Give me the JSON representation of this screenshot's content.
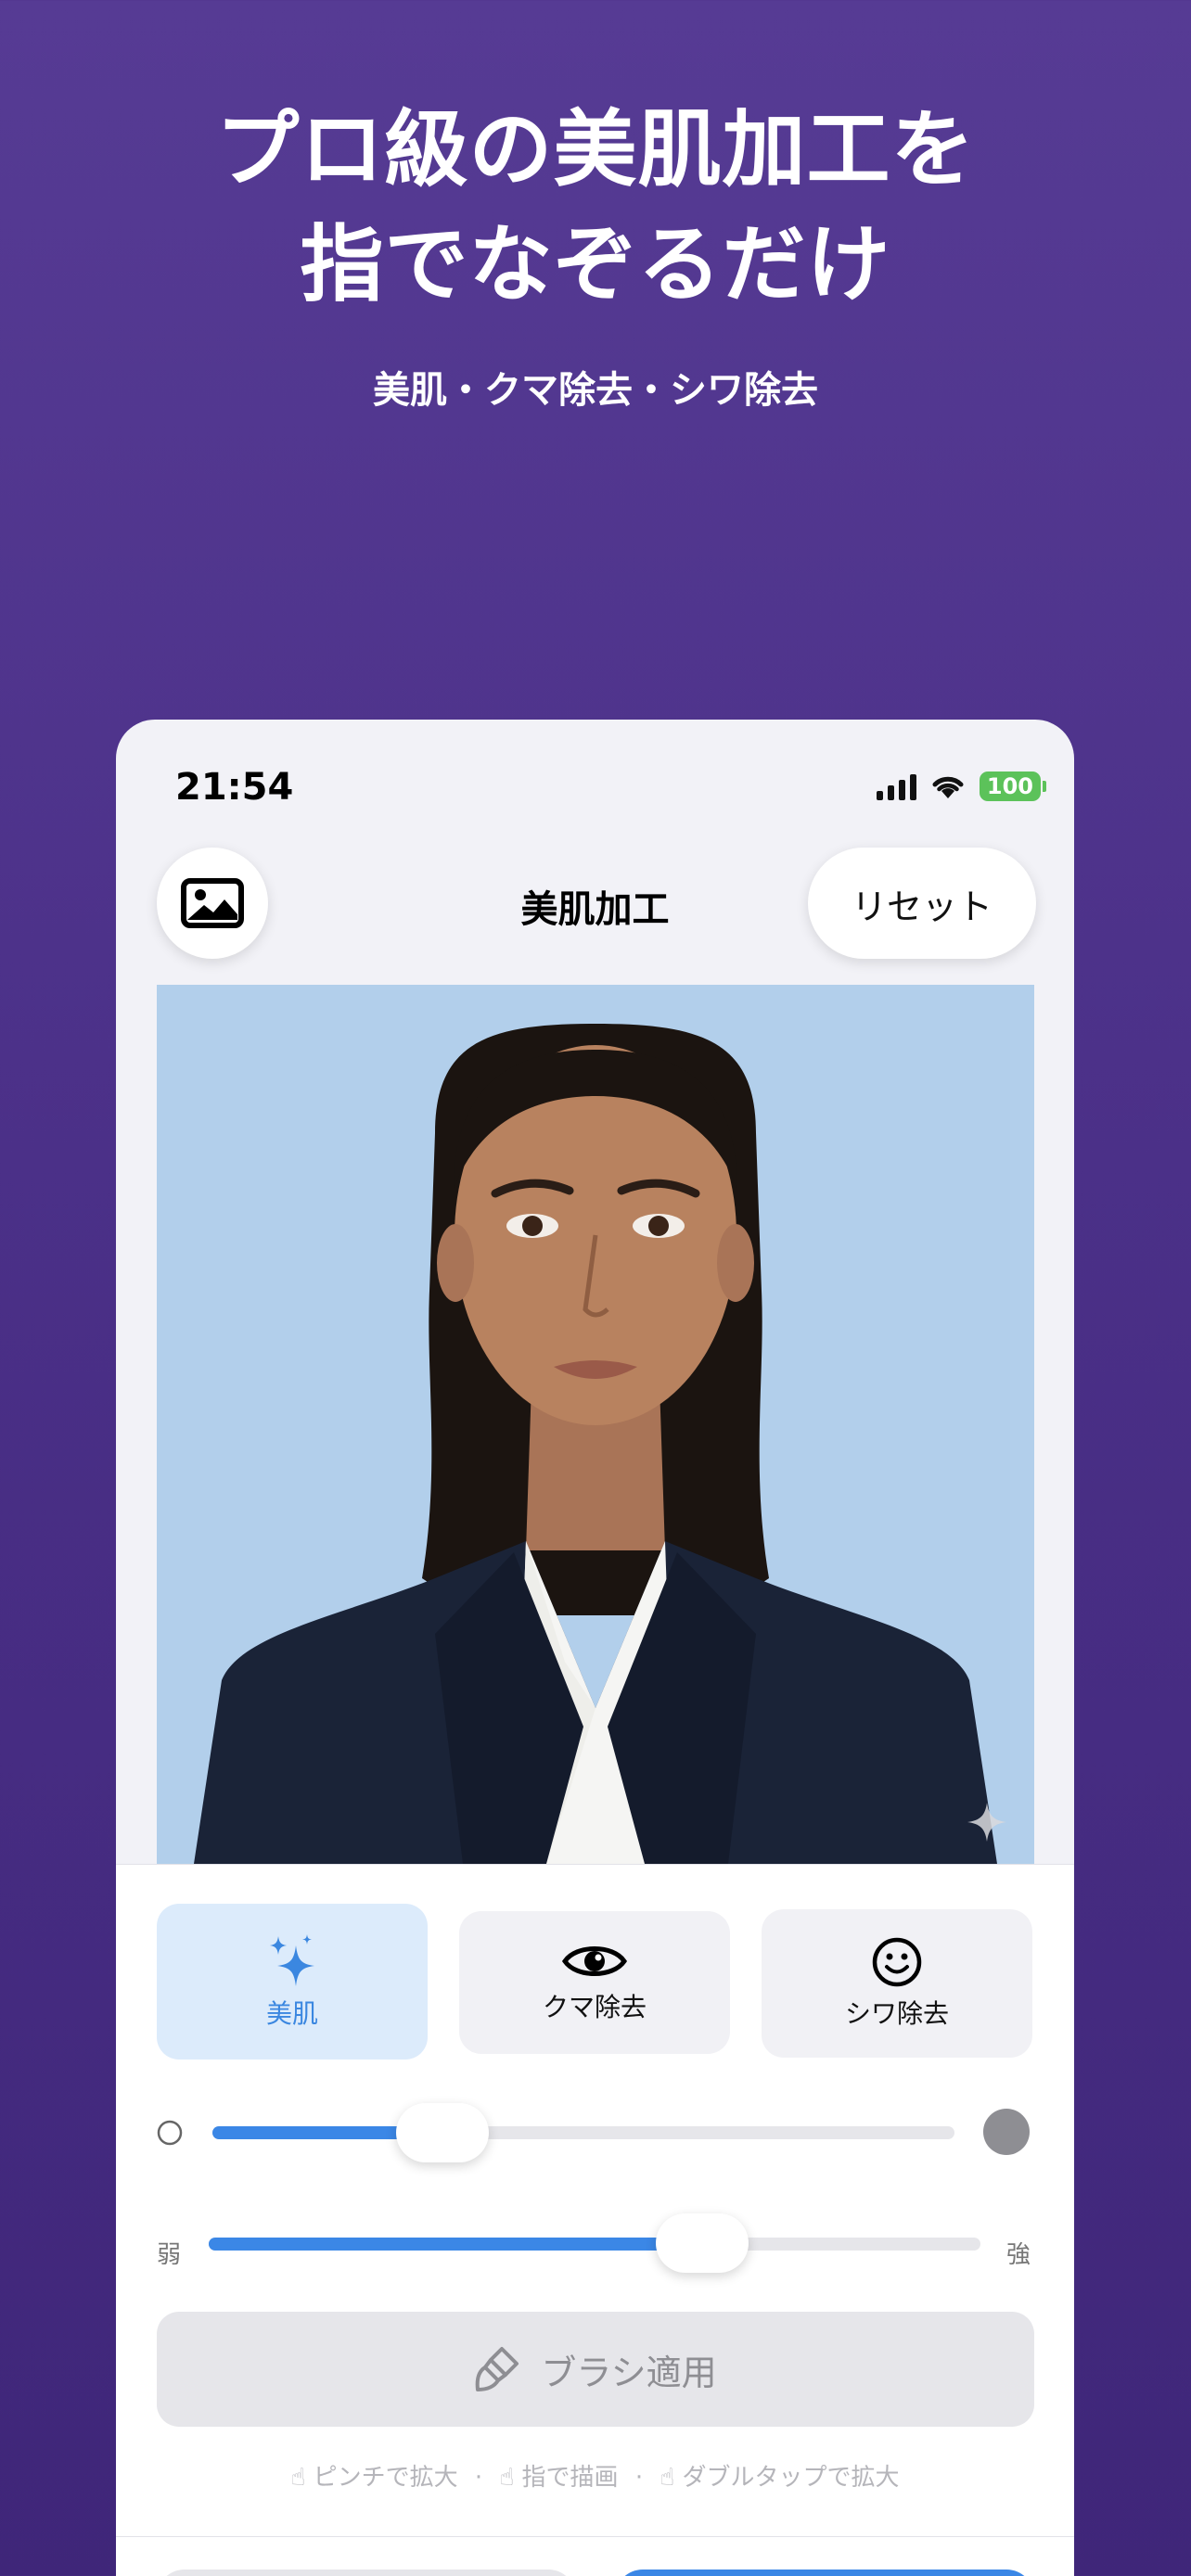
{
  "hero": {
    "title_line1": "プロ級の美肌加工を",
    "title_line2": "指でなぞるだけ",
    "subtitle": "美肌・クマ除去・シワ除去"
  },
  "status_bar": {
    "time": "21:54",
    "battery": "100"
  },
  "nav": {
    "title": "美肌加工",
    "reset_label": "リセット",
    "gallery_icon": "photo-gallery-icon"
  },
  "modes": [
    {
      "label": "美肌",
      "icon": "sparkles-icon",
      "active": true
    },
    {
      "label": "クマ除去",
      "icon": "eye-icon",
      "active": false
    },
    {
      "label": "シワ除去",
      "icon": "smiley-icon",
      "active": false
    }
  ],
  "brush_size_slider": {
    "value": 0.31
  },
  "strength_slider": {
    "min_label": "弱",
    "max_label": "強",
    "value": 0.64
  },
  "apply_button": {
    "label": "ブラシ適用"
  },
  "hint": {
    "pinch": "ピンチで拡大",
    "draw": "指で描画",
    "double_tap": "ダブルタップで拡大",
    "separator": "·"
  },
  "colors": {
    "accent": "#3b87e6",
    "active_mode_bg": "#dcebfb",
    "background_top": "#563b94",
    "background_bottom": "#3f2679"
  }
}
